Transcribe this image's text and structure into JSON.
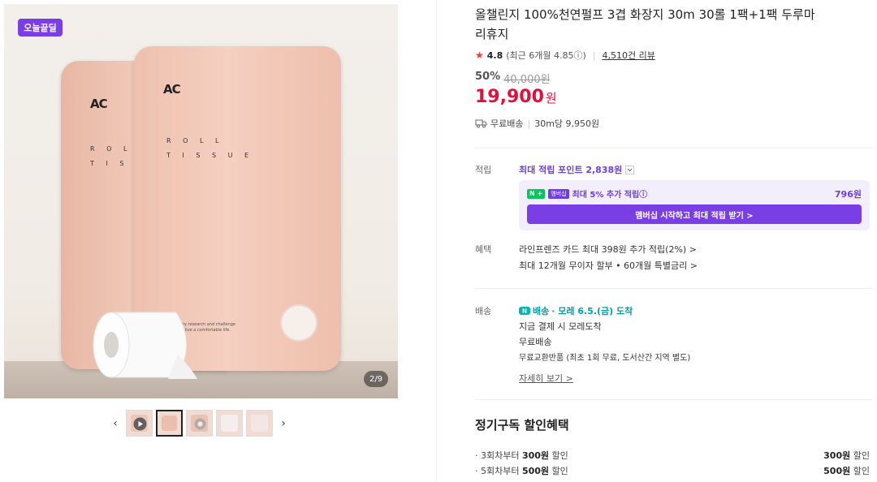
{
  "gallery": {
    "badge": "오늘끝딜",
    "pack_logo": "AC",
    "pack_text_front": "R O L L\nT I S S U E",
    "pack_text_back": "R O L L\nT I S S U E",
    "pack_small_text": "stenny research and challenge\nws to live a comfortable life.",
    "pager": "2/9",
    "prev_arrow": "‹",
    "next_arrow": "›",
    "thumbnails": [
      {
        "icon": "play-icon"
      },
      {
        "icon": "pack-icon"
      },
      {
        "icon": "texture-icon"
      },
      {
        "icon": "roll-icon"
      },
      {
        "icon": "pattern-icon"
      }
    ]
  },
  "product": {
    "title": "올챌린지 100%천연펄프 3겹 화장지 30m 30롤 1팩+1팩 두루마리휴지",
    "rating": "4.8",
    "rating_detail": "(최근 6개월 4.85ⓘ)",
    "reviews": "4,510건 리뷰",
    "discount_pct": "50%",
    "original_price": "40,000원",
    "price": "19,900",
    "price_unit": "원",
    "shipping": "무료배송",
    "unit_price": "30m당 9,950원"
  },
  "points": {
    "label": "적립",
    "max_points": "최대 적립 포인트 2,838원",
    "n_badge": "N",
    "membership_badge": "멤버십",
    "extra": "최대 5% 추가 적립ⓘ",
    "extra_amount": "796원",
    "button": "멤버십 시작하고 최대 적립 받기 >"
  },
  "benefits": {
    "label": "혜택",
    "line1": "라인프렌즈 카드 최대 398원 추가 적립(2%) >",
    "line2": "최대 12개월 무이자 할부 • 60개월 특별금리 >"
  },
  "delivery": {
    "label": "배송",
    "badge": "배송",
    "arrival": "· 모레 6.5.(금) 도착",
    "line1": "지금 결제 시 모레도착",
    "line2": "무료배송",
    "line3": "무료교환반품 (최초 1회 무료, 도서산간 지역 별도)",
    "more": "자세히 보기 >"
  },
  "subscription": {
    "title": "정기구독 할인혜택",
    "rows": [
      {
        "prefix": "· 3회차부터 ",
        "amount": "300원",
        "suffix": " 할인",
        "right_amount": "300원",
        "right_suffix": " 할인"
      },
      {
        "prefix": "· 5회차부터 ",
        "amount": "500원",
        "suffix": " 할인",
        "right_amount": "500원",
        "right_suffix": " 할인"
      }
    ]
  }
}
